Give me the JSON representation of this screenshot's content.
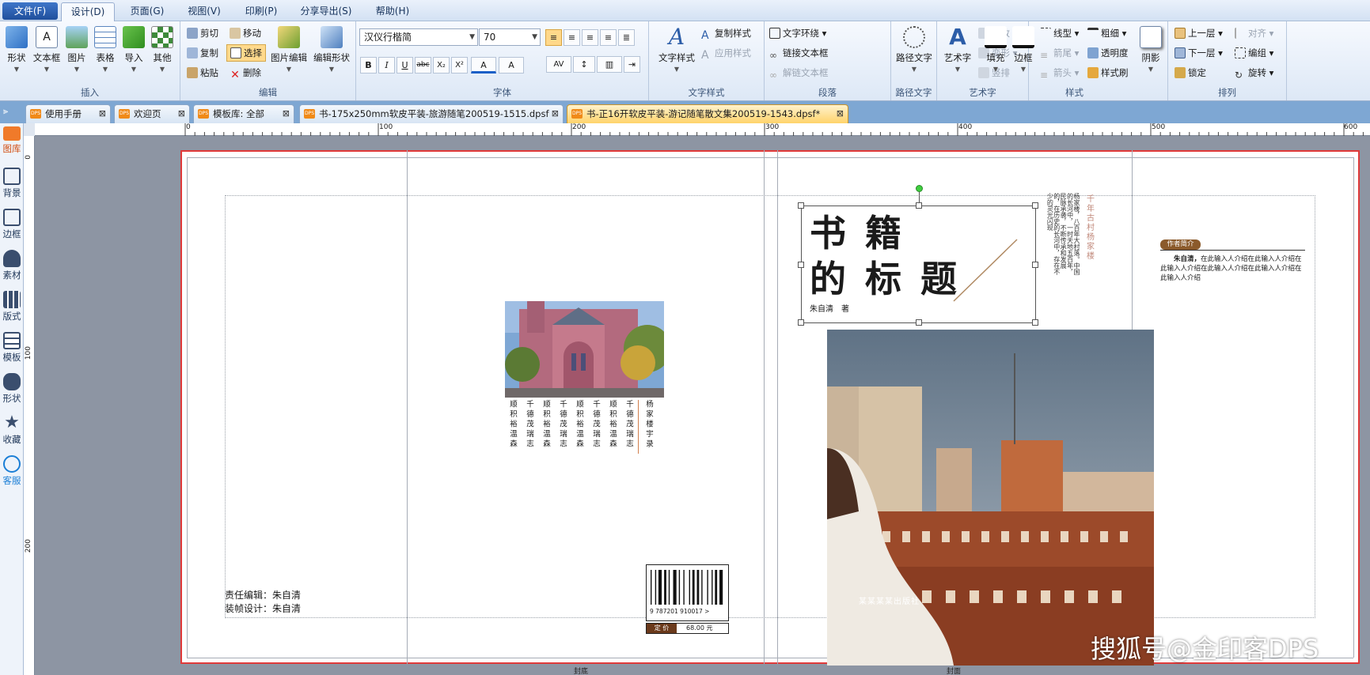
{
  "menu": {
    "file": "文件(F)",
    "design": "设计(D)",
    "page": "页面(G)",
    "view": "视图(V)",
    "print": "印刷(P)",
    "share": "分享导出(S)",
    "help": "帮助(H)"
  },
  "ribbon": {
    "insert": {
      "title": "插入",
      "shape": "形状",
      "textbox": "文本框",
      "image": "图片",
      "table": "表格",
      "import": "导入",
      "other": "其他"
    },
    "edit": {
      "title": "编辑",
      "cut": "剪切",
      "move": "移动",
      "copy": "复制",
      "select": "选择",
      "paste": "粘贴",
      "delete": "删除",
      "image_edit": "图片编辑",
      "edit_shape": "编辑形状"
    },
    "font": {
      "title": "字体",
      "family": "汉仪行楷简",
      "size": "70",
      "bold": "B",
      "italic": "I",
      "underline": "U",
      "strike": "abc",
      "sub": "X₂",
      "sup": "X²",
      "color": "A",
      "highlight": "A",
      "spacing": "AV"
    },
    "text_style": {
      "title": "文字样式",
      "text_style": "文字样式",
      "copy_style": "复制样式",
      "apply_style": "应用样式"
    },
    "paragraph": {
      "title": "段落",
      "wrap": "文字环绕",
      "link": "链接文本框",
      "unlink": "解链文本框"
    },
    "path_text": {
      "title": "路径文字",
      "label": "路径文字"
    },
    "art_text": {
      "title": "艺术字",
      "label": "艺术字",
      "modify": "修改",
      "transform": "变形",
      "vertical": "竖排"
    },
    "style": {
      "title": "样式",
      "fill": "填充",
      "border": "边框",
      "line_type": "线型",
      "arrow_end": "箭尾",
      "arrow_head": "箭头",
      "thickness": "粗细",
      "transparency": "透明度",
      "brush": "样式刷",
      "shadow": "阴影"
    },
    "arrange": {
      "title": "排列",
      "up": "上一层",
      "down": "下一层",
      "lock": "锁定",
      "align": "对齐",
      "group": "编组",
      "rotate": "旋转"
    }
  },
  "tabs": [
    "使用手册",
    "欢迎页",
    "模板库: 全部",
    "书-175x250mm软皮平装-旅游随笔200519-1515.dpsf",
    "书-正16开软皮平装-游记随笔散文集200519-1543.dpsf*"
  ],
  "left_panel": [
    "图库",
    "背景",
    "边框",
    "素材",
    "版式",
    "模板",
    "形状",
    "收藏",
    "客服"
  ],
  "ruler": {
    "h": [
      "0",
      "100",
      "200",
      "300",
      "400",
      "500",
      "600"
    ],
    "v": [
      "0",
      "100",
      "200"
    ]
  },
  "cover": {
    "title_line1": "书 籍",
    "title_line2": "的 标 题",
    "author": "朱自清　著",
    "vertical_red": "千年古村杨家楼",
    "vertical_body": "杨家楼，八百年大村落。中国的长河中，一时天地五百年，民脉承袭，不断传承和发展的，在历史的长河中，存在不少的灵光闪现",
    "author_intro_badge": "作者简介",
    "author_intro_name": "朱自清，",
    "author_intro_text": "在此输入人介绍在此输入人介绍在此输入人介绍在此输入人介绍在此输入人介绍在此输入人介绍",
    "publisher": "某某某某出版社"
  },
  "back": {
    "poem_cols": [
      "顺积裕温森",
      "千德茂瑞志",
      "顺积裕温森",
      "千德茂瑞志",
      "顺积裕温森",
      "千德茂瑞志",
      "顺积裕温森",
      "千德茂瑞志"
    ],
    "poem_title": "杨家楼宇录",
    "editor": "责任编辑：朱自清",
    "designer": "装帧设计：朱自清",
    "isbn": "9 787201 910017 >",
    "price_label": "定 价",
    "price_value": "68.00 元"
  },
  "labels": {
    "back_cover": "封底",
    "front_cover": "封面"
  },
  "watermark": "搜狐号@金印客DPS"
}
